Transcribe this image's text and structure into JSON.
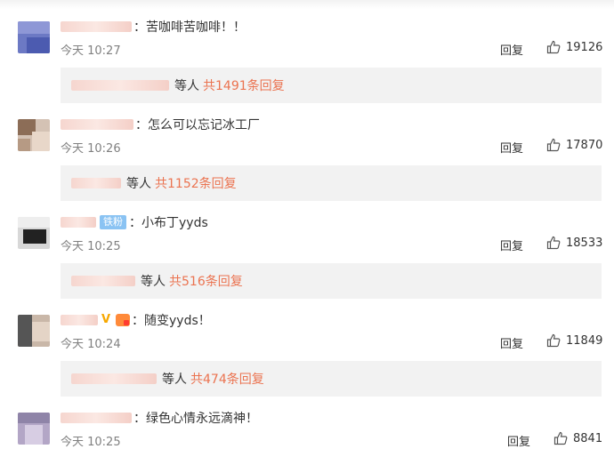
{
  "comments": [
    {
      "text": "苦咖啡苦咖啡！！",
      "time": "今天 10:27",
      "reply_label": "回复",
      "likes": "19126",
      "sub_etc": "等人",
      "sub_total": "共1491条回复",
      "badges": []
    },
    {
      "text": "怎么可以忘记冰工厂",
      "time": "今天 10:26",
      "reply_label": "回复",
      "likes": "17870",
      "sub_etc": "等人",
      "sub_total": "共1152条回复",
      "badges": []
    },
    {
      "text": "小布丁yyds",
      "time": "今天 10:25",
      "reply_label": "回复",
      "likes": "18533",
      "sub_etc": "等人",
      "sub_total": "共516条回复",
      "badges": [
        "铁粉"
      ]
    },
    {
      "text": "随变yyds！",
      "time": "今天 10:24",
      "reply_label": "回复",
      "likes": "11849",
      "sub_etc": "等人",
      "sub_total": "共474条回复",
      "badges": [
        "V",
        "gift"
      ]
    },
    {
      "text": "绿色心情永远滴神！",
      "time": "今天 10:25",
      "reply_label": "回复",
      "likes": "8841"
    }
  ],
  "colors": {
    "link_orange": "#eb7350",
    "muted": "#808080",
    "sub_bg": "#f2f2f2",
    "fan_badge": "#8ac3f3"
  },
  "icons": [
    "thumbs-up-icon",
    "verified-v-icon",
    "gift-badge-icon"
  ]
}
